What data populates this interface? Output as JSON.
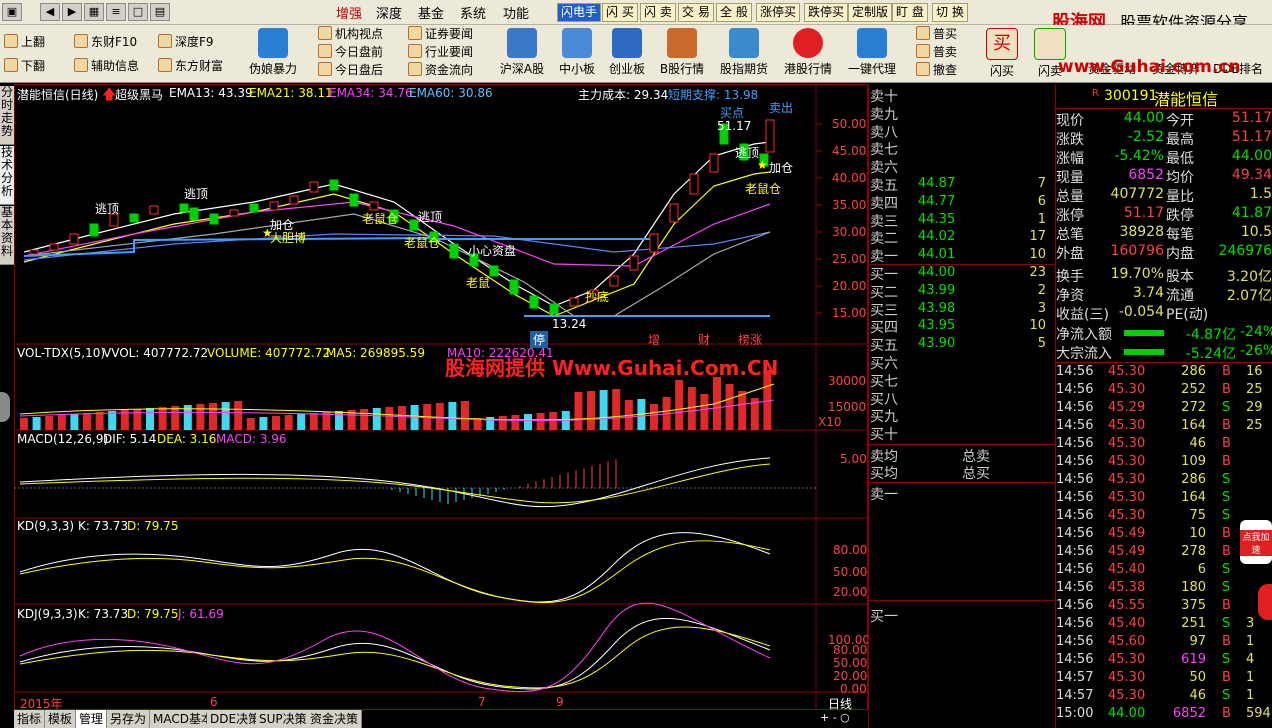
{
  "menubar": {
    "items": [
      "增强",
      "深度",
      "基金",
      "系统",
      "功能"
    ],
    "func_buttons": [
      "闪电手",
      "闪 买",
      "闪 卖",
      "交 易",
      "全 般",
      "涨停买",
      "跌停买",
      "定制版",
      "盯 盘",
      "切 换"
    ]
  },
  "brand": {
    "name": "股海网",
    "slogan": "股票软件资源分享",
    "url": "www.Guhai.com.cn"
  },
  "toolbar": {
    "small_col1": [
      "上翻",
      "下翻"
    ],
    "small_col2": [
      "东财F10",
      "辅助信息"
    ],
    "small_col3": [
      "深度F9",
      "东方财富"
    ],
    "small_col4": [
      "机构视点",
      "今日盘前",
      "今日盘后"
    ],
    "small_col5": [
      "证券要闻",
      "行业要闻",
      "资金流向"
    ],
    "big": [
      "伪娘暴力",
      "沪深A股",
      "中小板",
      "创业板",
      "B股行情",
      "股指期货",
      "港股行情",
      "一键代理"
    ],
    "small_col6": [
      "普买",
      "普卖",
      "撤查"
    ],
    "big_right": [
      "闪买",
      "闪卖",
      "资金驱动",
      "资金博弈",
      "DDE排名"
    ]
  },
  "sidetabs": [
    "分时走势",
    "技术分析",
    "基本资料"
  ],
  "chart": {
    "title": "潜能恒信(日线)",
    "indicator": "超级黑马",
    "ema13": "EMA13: 43.39",
    "ema21": "EMA21: 38.11",
    "ema34": "EMA34: 34.76",
    "ema60": "EMA60: 30.86",
    "cost": "主力成本: 29.34",
    "support": "短期支撑: 13.98",
    "y_labels": [
      "50.00",
      "45.00",
      "40.00",
      "35.00",
      "30.00",
      "25.00",
      "20.00",
      "15.00"
    ],
    "annotations": [
      "逃顶",
      "逃顶",
      "加仓",
      "大胆博",
      "老鼠仓",
      "逃顶",
      "老鼠仓",
      "小心资盘",
      "老鼠",
      "小心资盘",
      "抄底",
      "老鼠仓",
      "逃顶",
      "加仓",
      "老鼠仓",
      "51.17",
      "13.24",
      "买点",
      "卖出"
    ],
    "event_markers": [
      "增",
      "财",
      "榜涨"
    ],
    "stop_label": "停",
    "watermark": "股海网提供 Www.Guhai.Com.CN",
    "vol_title": "VOL-TDX(5,10)",
    "vvol": "VVOL: 407772.72",
    "volume": "VOLUME: 407772.72",
    "vma5": "MA5: 269895.59",
    "vma10": "MA10: 222620.41",
    "vol_labels": [
      "30000",
      "15000",
      "X10"
    ],
    "macd_title": "MACD(12,26,9)",
    "macd_dif": "DIF: 5.14",
    "macd_dea": "DEA: 3.16",
    "macd_val": "MACD: 3.96",
    "macd_labels": [
      "5.00"
    ],
    "kd_title": "KD(9,3,3)",
    "kd_k": "K: 73.73",
    "kd_d": "D: 79.75",
    "kd_labels": [
      "80.00",
      "50.00",
      "20.00"
    ],
    "kdj_title": "KDJ(9,3,3)",
    "kdj_k": "K: 73.73",
    "kdj_d": "D: 79.75",
    "kdj_j": "J: 61.69",
    "kdj_labels": [
      "100.00",
      "80.00",
      "50.00",
      "20.00",
      "0.00"
    ],
    "x_labels": [
      "2015年",
      "6",
      "7",
      "9"
    ],
    "period": "日线"
  },
  "bottom_tabs": [
    "指标",
    "模板",
    "管理",
    "另存为",
    "MACD基本",
    "DDE决策",
    "SUP决策",
    "资金决策"
  ],
  "orderbook": {
    "sell": [
      {
        "label": "卖十",
        "price": "",
        "vol": ""
      },
      {
        "label": "卖九",
        "price": "",
        "vol": ""
      },
      {
        "label": "卖八",
        "price": "",
        "vol": ""
      },
      {
        "label": "卖七",
        "price": "",
        "vol": ""
      },
      {
        "label": "卖六",
        "price": "",
        "vol": ""
      },
      {
        "label": "卖五",
        "price": "44.87",
        "vol": "7"
      },
      {
        "label": "卖四",
        "price": "44.77",
        "vol": "6"
      },
      {
        "label": "卖三",
        "price": "44.35",
        "vol": "1"
      },
      {
        "label": "卖二",
        "price": "44.02",
        "vol": "17"
      },
      {
        "label": "卖一",
        "price": "44.01",
        "vol": "10"
      }
    ],
    "buy": [
      {
        "label": "买一",
        "price": "44.00",
        "vol": "23"
      },
      {
        "label": "买二",
        "price": "43.99",
        "vol": "2"
      },
      {
        "label": "买三",
        "price": "43.98",
        "vol": "3"
      },
      {
        "label": "买四",
        "price": "43.95",
        "vol": "10"
      },
      {
        "label": "买五",
        "price": "43.90",
        "vol": "5"
      },
      {
        "label": "买六",
        "price": "",
        "vol": ""
      },
      {
        "label": "买七",
        "price": "",
        "vol": ""
      },
      {
        "label": "买八",
        "price": "",
        "vol": ""
      },
      {
        "label": "买九",
        "price": "",
        "vol": ""
      },
      {
        "label": "买十",
        "price": "",
        "vol": ""
      }
    ],
    "avg_sell": "卖均",
    "avg_buy": "买均",
    "total_sell": "总卖",
    "total_buy": "总买",
    "sell_one": "卖一",
    "buy_one": "买一"
  },
  "stock": {
    "tag": "R",
    "code": "300191",
    "name": "潜能恒信",
    "rows": [
      {
        "l1": "现价",
        "v1": "44.00",
        "l2": "今开",
        "v2": "51.17",
        "c1": "#00e000",
        "c2": "#ff4040"
      },
      {
        "l1": "涨跌",
        "v1": "-2.52",
        "l2": "最高",
        "v2": "51.17",
        "c1": "#00e000",
        "c2": "#ff4040"
      },
      {
        "l1": "涨幅",
        "v1": "-5.42%",
        "l2": "最低",
        "v2": "44.00",
        "c1": "#00e000",
        "c2": "#00e000"
      },
      {
        "l1": "现量",
        "v1": "6852",
        "l2": "均价",
        "v2": "49.34",
        "c1": "#ff40ff",
        "c2": "#ff4040"
      },
      {
        "l1": "总量",
        "v1": "407772",
        "l2": "量比",
        "v2": "1.5",
        "c1": "#e0e060",
        "c2": "#e0e060"
      },
      {
        "l1": "涨停",
        "v1": "51.17",
        "l2": "跌停",
        "v2": "41.87",
        "c1": "#ff4040",
        "c2": "#00e000"
      },
      {
        "l1": "总笔",
        "v1": "38928",
        "l2": "每笔",
        "v2": "10.5",
        "c1": "#e0e060",
        "c2": "#e0e060"
      },
      {
        "l1": "外盘",
        "v1": "160796",
        "l2": "内盘",
        "v2": "246976",
        "c1": "#ff4040",
        "c2": "#00e000"
      },
      {
        "l1": "换手",
        "v1": "19.70%",
        "l2": "股本",
        "v2": "3.20亿",
        "c1": "#e0e060",
        "c2": "#e0e060"
      },
      {
        "l1": "净资",
        "v1": "3.74",
        "l2": "流通",
        "v2": "2.07亿",
        "c1": "#e0e060",
        "c2": "#e0e060"
      },
      {
        "l1": "收益(三)",
        "v1": "-0.054",
        "l2": "PE(动)",
        "v2": "",
        "c1": "#e0e060",
        "c2": "#e0e060"
      }
    ],
    "flow": [
      {
        "label": "净流入额",
        "value": "-4.87亿",
        "pct": "-24%"
      },
      {
        "label": "大宗流入",
        "value": "-5.24亿",
        "pct": "-26%"
      }
    ]
  },
  "ticks": [
    {
      "time": "14:56",
      "price": "45.30",
      "vol": "286",
      "bs": "B",
      "n": "16"
    },
    {
      "time": "14:56",
      "price": "45.30",
      "vol": "252",
      "bs": "B",
      "n": "25"
    },
    {
      "time": "14:56",
      "price": "45.29",
      "vol": "272",
      "bs": "S",
      "n": "29"
    },
    {
      "time": "14:56",
      "price": "45.30",
      "vol": "164",
      "bs": "B",
      "n": "25"
    },
    {
      "time": "14:56",
      "price": "45.30",
      "vol": "46",
      "bs": "B",
      "n": ""
    },
    {
      "time": "14:56",
      "price": "45.30",
      "vol": "109",
      "bs": "B",
      "n": ""
    },
    {
      "time": "14:56",
      "price": "45.30",
      "vol": "286",
      "bs": "S",
      "n": ""
    },
    {
      "time": "14:56",
      "price": "45.30",
      "vol": "164",
      "bs": "S",
      "n": ""
    },
    {
      "time": "14:56",
      "price": "45.30",
      "vol": "75",
      "bs": "S",
      "n": ""
    },
    {
      "time": "14:56",
      "price": "45.49",
      "vol": "10",
      "bs": "B",
      "n": ""
    },
    {
      "time": "14:56",
      "price": "45.49",
      "vol": "278",
      "bs": "B",
      "n": ""
    },
    {
      "time": "14:56",
      "price": "45.40",
      "vol": "6",
      "bs": "S",
      "n": ""
    },
    {
      "time": "14:56",
      "price": "45.38",
      "vol": "180",
      "bs": "S",
      "n": ""
    },
    {
      "time": "14:56",
      "price": "45.55",
      "vol": "375",
      "bs": "B",
      "n": ""
    },
    {
      "time": "14:56",
      "price": "45.40",
      "vol": "251",
      "bs": "S",
      "n": "3"
    },
    {
      "time": "14:56",
      "price": "45.60",
      "vol": "97",
      "bs": "B",
      "n": "1"
    },
    {
      "time": "14:56",
      "price": "45.30",
      "vol": "619",
      "bs": "S",
      "n": "4"
    },
    {
      "time": "14:57",
      "price": "45.30",
      "vol": "50",
      "bs": "B",
      "n": "1"
    },
    {
      "time": "14:57",
      "price": "45.30",
      "vol": "46",
      "bs": "S",
      "n": "1"
    },
    {
      "time": "15:00",
      "price": "44.00",
      "vol": "6852",
      "bs": "B",
      "n": "594"
    }
  ],
  "float_ad": "点我加速",
  "colors": {
    "bg": "#000000",
    "up": "#ff3333",
    "down": "#00dddd",
    "grid": "#8b0000",
    "text_white": "#ffffff",
    "yellow": "#ffff00"
  }
}
